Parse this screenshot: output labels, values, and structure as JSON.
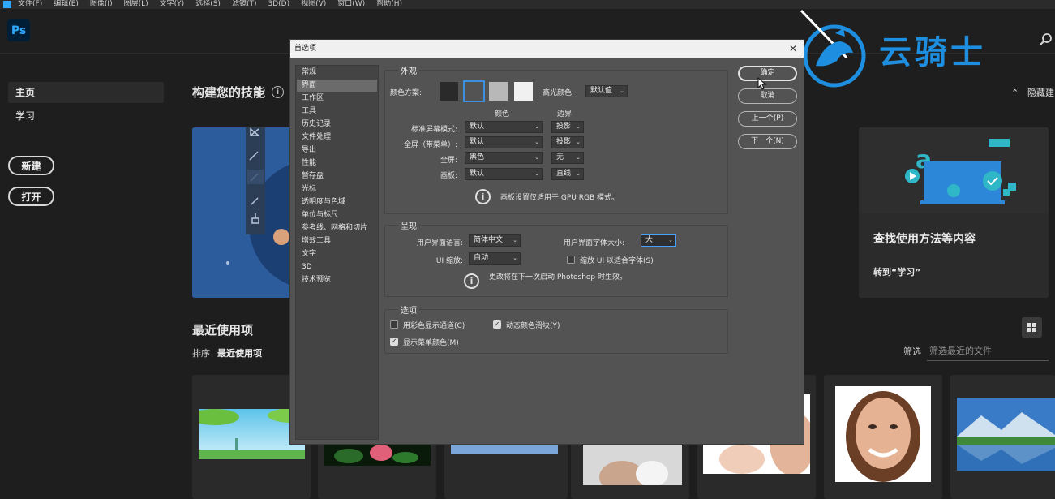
{
  "menubar": {
    "items": [
      "文件(F)",
      "编辑(E)",
      "图像(I)",
      "图层(L)",
      "文字(Y)",
      "选择(S)",
      "滤镜(T)",
      "3D(D)",
      "视图(V)",
      "窗口(W)",
      "帮助(H)"
    ]
  },
  "app": {
    "logo": "Ps"
  },
  "nav": {
    "home": "主页",
    "learn": "学习",
    "new": "新建",
    "open": "打开"
  },
  "home": {
    "skills_title": "构建您的技能",
    "hide_label": "隐藏建",
    "promo_title": "查找使用方法等内容",
    "promo_link": "转到“学习”",
    "recent_title": "最近使用项",
    "sort_label": "排序",
    "sort_value": "最近使用项",
    "filter_label": "筛选",
    "filter_placeholder": "筛选最近的文件"
  },
  "watermark": {
    "text": "云骑士"
  },
  "dialog": {
    "title": "首选项",
    "categories": [
      "常规",
      "界面",
      "工作区",
      "工具",
      "历史记录",
      "文件处理",
      "导出",
      "性能",
      "暂存盘",
      "光标",
      "透明度与色域",
      "单位与标尺",
      "参考线、网格和切片",
      "增效工具",
      "文字",
      "3D",
      "技术预览"
    ],
    "selected_category": "界面",
    "appearance": {
      "title": "外观",
      "color_scheme_label": "颜色方案:",
      "highlight_label": "高光颜色:",
      "highlight_value": "默认值",
      "col_color": "颜色",
      "col_border": "边界",
      "rows": [
        {
          "label": "标准屏幕模式:",
          "color": "默认",
          "border": "投影"
        },
        {
          "label": "全屏（带菜单）:",
          "color": "默认",
          "border": "投影"
        },
        {
          "label": "全屏:",
          "color": "黑色",
          "border": "无"
        },
        {
          "label": "画板:",
          "color": "默认",
          "border": "直线"
        }
      ],
      "note": "画板设置仅适用于 GPU RGB 模式。"
    },
    "presentation": {
      "title": "呈现",
      "ui_language_label": "用户界面语言:",
      "ui_language_value": "简体中文",
      "ui_font_size_label": "用户界面字体大小:",
      "ui_font_size_value": "大",
      "ui_scale_label": "UI 缩放:",
      "ui_scale_value": "自动",
      "scale_fit_label": "缩放 UI 以适合字体(S)",
      "note": "更改将在下一次启动 Photoshop 时生效。"
    },
    "options": {
      "title": "选项",
      "color_channels_label": "用彩色显示通道(C)",
      "dynamic_sliders_label": "动态颜色滑块(Y)",
      "menu_colors_label": "显示菜单颜色(M)"
    },
    "buttons": {
      "ok": "确定",
      "cancel": "取消",
      "prev": "上一个(P)",
      "next": "下一个(N)"
    }
  }
}
